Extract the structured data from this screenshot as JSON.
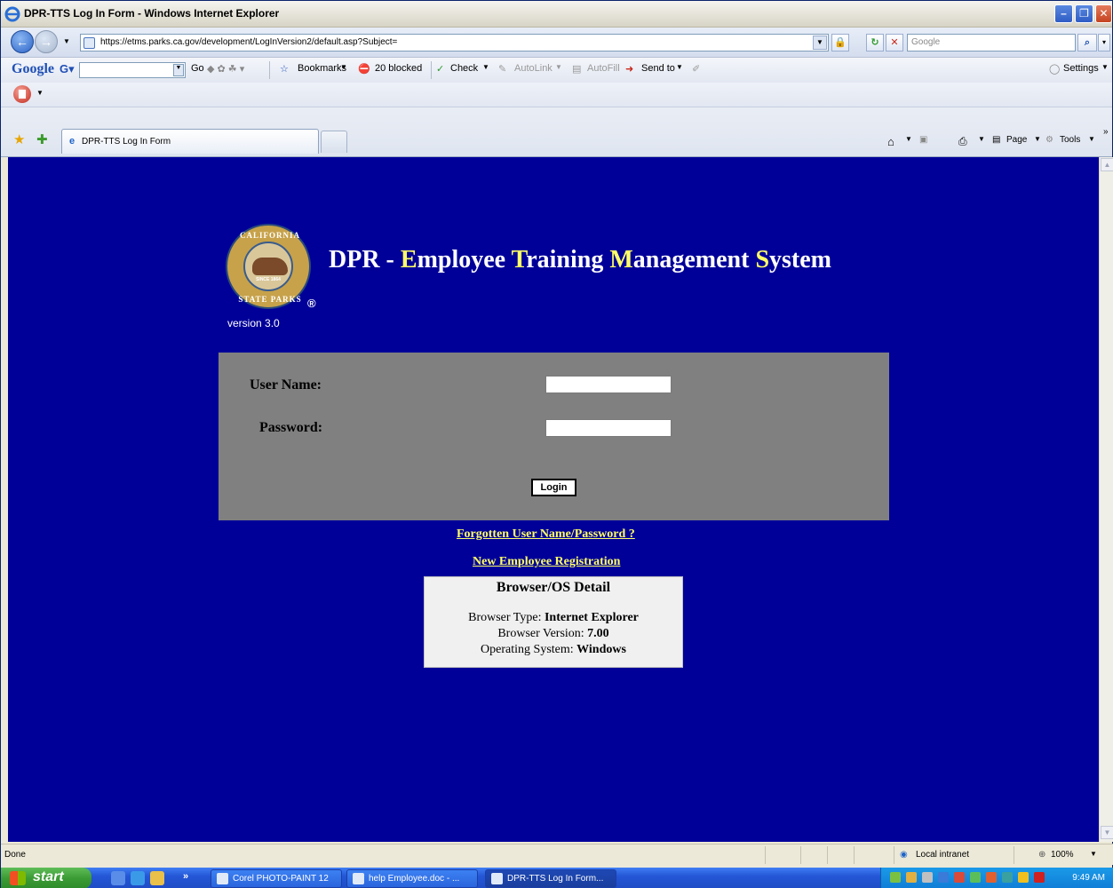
{
  "window": {
    "title": "DPR-TTS Log In Form - Windows Internet Explorer"
  },
  "address": {
    "url": "https://etms.parks.ca.gov/development/LogInVersion2/default.asp?Subject="
  },
  "search": {
    "placeholder": "Google"
  },
  "google_toolbar": {
    "logo": "Google",
    "go": "Go",
    "bookmarks": "Bookmarks",
    "blocked": "20 blocked",
    "check": "Check",
    "autolink": "AutoLink",
    "autofill": "AutoFill",
    "sendto": "Send to",
    "settings": "Settings"
  },
  "tab": {
    "label": "DPR-TTS Log In Form"
  },
  "commandbar": {
    "page": "Page",
    "tools": "Tools"
  },
  "header": {
    "title_parts": [
      "DPR - ",
      "E",
      "mployee ",
      "T",
      "raining ",
      "M",
      "anagement ",
      "S",
      "ystem"
    ],
    "version": "version 3.0",
    "seal_top": "CALIFORNIA",
    "seal_bottom": "STATE PARKS",
    "seal_year": "SINCE 1864"
  },
  "login": {
    "username_label": "User Name:",
    "password_label": "Password:",
    "username_value": "",
    "password_value": "",
    "login_button": "Login"
  },
  "links": {
    "forgot": "Forgotten User Name/Password ?",
    "register": "New Employee Registration"
  },
  "browser_detail": {
    "heading": "Browser/OS Detail",
    "browser_type_label": "Browser Type: ",
    "browser_type": "Internet Explorer",
    "browser_version_label": "Browser Version: ",
    "browser_version": "7.00",
    "os_label": "Operating System: ",
    "os": "Windows"
  },
  "statusbar": {
    "status": "Done",
    "zone": "Local intranet",
    "zoom": "100%"
  },
  "taskbar": {
    "start": "start",
    "tasks": [
      "Corel PHOTO-PAINT 12",
      "help Employee.doc - ...",
      "DPR-TTS Log In Form..."
    ],
    "clock": "9:49 AM"
  },
  "colors": {
    "page_bg": "#000099",
    "highlight": "#ffff66",
    "panel_bg": "#808080"
  }
}
